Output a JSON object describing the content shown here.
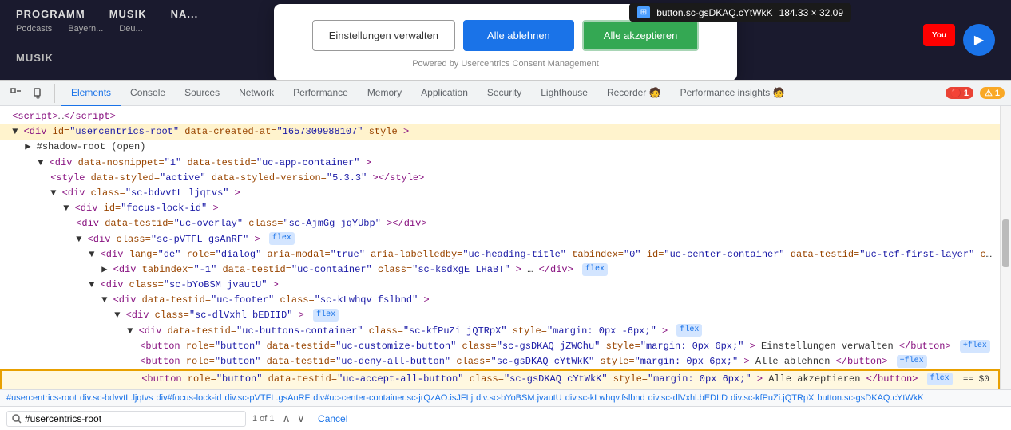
{
  "website": {
    "nav_items": [
      "PROGRAMM",
      "MUSIK",
      "NA..."
    ],
    "sub_items": [
      "Podcasts",
      "Bayern...",
      "Deu..."
    ],
    "music_label": "MUSIK"
  },
  "consent": {
    "manage_label": "Einstellungen verwalten",
    "reject_label": "Alle ablehnen",
    "accept_label": "Alle akzeptieren",
    "powered_text": "Powered by Usercentrics Consent Management"
  },
  "tooltip": {
    "icon_label": "⊞",
    "element_name": "button.sc-gsDKAQ.cYtWkK",
    "dimensions": "184.33 × 32.09"
  },
  "devtools": {
    "tabs": [
      {
        "label": "Elements",
        "active": true
      },
      {
        "label": "Console",
        "active": false
      },
      {
        "label": "Sources",
        "active": false
      },
      {
        "label": "Network",
        "active": false
      },
      {
        "label": "Performance",
        "active": false
      },
      {
        "label": "Memory",
        "active": false
      },
      {
        "label": "Application",
        "active": false
      },
      {
        "label": "Security",
        "active": false
      },
      {
        "label": "Lighthouse",
        "active": false
      },
      {
        "label": "Recorder 🧑",
        "active": false
      },
      {
        "label": "Performance insights 🧑",
        "active": false
      }
    ],
    "error_count": "1",
    "warn_count": "1"
  },
  "dom": {
    "lines": [
      {
        "indent": 0,
        "html": "&lt;script&gt;…&lt;/script&gt;"
      },
      {
        "indent": 0,
        "html": "▼ <span class='tag'>&lt;div</span> <span class='attr-name'>id=</span><span class='attr-value'>\"usercentrics-root\"</span> <span class='attr-name'>data-created-at=</span><span class='attr-value'>\"1657309988107\"</span> <span class='attr-name'>style</span><span class='tag'>&gt;</span>"
      },
      {
        "indent": 1,
        "html": "▶ #shadow-root (open)"
      },
      {
        "indent": 2,
        "html": "▼ <span class='tag'>&lt;div</span> <span class='attr-name'>data-nosnippet=</span><span class='attr-value'>\"1\"</span> <span class='attr-name'>data-testid=</span><span class='attr-value'>\"uc-app-container\"</span><span class='tag'>&gt;</span>"
      },
      {
        "indent": 3,
        "html": "<span class='tag'>&lt;style</span> <span class='attr-name'>data-styled=</span><span class='attr-value'>\"active\"</span> <span class='attr-name'>data-styled-version=</span><span class='attr-value'>\"5.3.3\"</span><span class='tag'>&gt;&lt;/style&gt;</span>"
      },
      {
        "indent": 3,
        "html": "▼ <span class='tag'>&lt;div</span> <span class='attr-name'>class=</span><span class='attr-value'>\"sc-bdvvtL ljqtvs\"</span><span class='tag'>&gt;</span>"
      },
      {
        "indent": 4,
        "html": "▼ <span class='tag'>&lt;div</span> <span class='attr-name'>id=</span><span class='attr-value'>\"focus-lock-id\"</span><span class='tag'>&gt;</span>"
      },
      {
        "indent": 5,
        "html": "<span class='tag'>&lt;div</span> <span class='attr-name'>data-testid=</span><span class='attr-value'>\"uc-overlay\"</span> <span class='attr-name'>class=</span><span class='attr-value'>\"sc-AjmGg jqYUbp\"</span><span class='tag'>&gt;&lt;/div&gt;</span>"
      },
      {
        "indent": 5,
        "html": "▼ <span class='tag'>&lt;div</span> <span class='attr-name'>class=</span><span class='attr-value'>\"sc-pVTFL gsAnRF\"</span><span class='tag'>&gt;</span> <span class='badge-flex'>flex</span>"
      },
      {
        "indent": 6,
        "html": "▼ <span class='tag'>&lt;div</span> <span class='attr-name'>lang=</span><span class='attr-value'>\"de\"</span> <span class='attr-name'>role=</span><span class='attr-value'>\"dialog\"</span> <span class='attr-name'>aria-modal=</span><span class='attr-value'>\"true\"</span> <span class='attr-name'>aria-labelledby=</span><span class='attr-value'>\"uc-heading-title\"</span> <span class='attr-name'>tabindex=</span><span class='attr-value'>\"0\"</span> <span class='attr-name'>id=</span><span class='attr-value'>\"uc-center-container\"</span> <span class='attr-name'>data-testid=</span><span class='attr-value'>\"uc-tcf-first-layer\"</span> <span class='attr-name'>class=</span><span class='attr-value'>\"sc-jrQzAO i</span>"
      },
      {
        "indent": 7,
        "html": "▶ <span class='tag'>&lt;div</span> <span class='attr-name'>tabindex=</span><span class='attr-value'>\"-1\"</span> <span class='attr-name'>data-testid=</span><span class='attr-value'>\"uc-container\"</span> <span class='attr-name'>class=</span><span class='attr-value'>\"sc-ksdxgE LHaBT\"</span><span class='tag'>&gt;</span>…<span class='tag'>&lt;/div&gt;</span> <span class='badge-flex'>flex</span>"
      },
      {
        "indent": 6,
        "html": "▼ <span class='tag'>&lt;div</span> <span class='attr-name'>class=</span><span class='attr-value'>\"sc-bYoBSM jvautU\"</span><span class='tag'>&gt;</span>"
      },
      {
        "indent": 7,
        "html": "▼ <span class='tag'>&lt;div</span> <span class='attr-name'>data-testid=</span><span class='attr-value'>\"uc-footer\"</span> <span class='attr-name'>class=</span><span class='attr-value'>\"sc-kLwhqv fslbnd\"</span><span class='tag'>&gt;</span>"
      },
      {
        "indent": 8,
        "html": "▼ <span class='tag'>&lt;div</span> <span class='attr-name'>class=</span><span class='attr-value'>\"sc-dlVxhl bEDIID\"</span><span class='tag'>&gt;</span> <span class='badge-flex'>flex</span>"
      },
      {
        "indent": 9,
        "html": "▼ <span class='tag'>&lt;div</span> <span class='attr-name'>data-testid=</span><span class='attr-value'>\"uc-buttons-container\"</span> <span class='attr-name'>class=</span><span class='attr-value'>\"sc-kfPuZi jQTRpX\"</span> <span class='attr-name'>style=</span><span class='attr-value'>\"margin: 0px -6px;\"</span><span class='tag'>&gt;</span> <span class='badge-flex'>flex</span>"
      },
      {
        "indent": 10,
        "html": "<span class='tag'>&lt;button</span> <span class='attr-name'>role=</span><span class='attr-value'>\"button\"</span> <span class='attr-name'>data-testid=</span><span class='attr-value'>\"uc-customize-button\"</span> <span class='attr-name'>class=</span><span class='attr-value'>\"sc-gsDKAQ jZWChu\"</span> <span class='attr-name'>style=</span><span class='attr-value'>\"margin: 0px 6px;\"</span><span class='tag'>&gt;</span>Einstellungen verwalten<span class='tag'>&lt;/button&gt;</span> <span class='badge-flex'>+flex</span>"
      },
      {
        "indent": 10,
        "html": "<span class='tag'>&lt;button</span> <span class='attr-name'>role=</span><span class='attr-value'>\"button\"</span> <span class='attr-name'>data-testid=</span><span class='attr-value'>\"uc-deny-all-button\"</span> <span class='attr-name'>class=</span><span class='attr-value'>\"sc-gsDKAQ cYtWkK\"</span> <span class='attr-name'>style=</span><span class='attr-value'>\"margin: 0px 6px;\"</span><span class='tag'>&gt;</span>Alle ablehnen<span class='tag'>&lt;/button&gt;</span> <span class='badge-flex'>+flex</span>"
      },
      {
        "indent": 10,
        "html": "<span class='tag'>&lt;button</span> <span class='attr-name'>role=</span><span class='attr-value'>\"button\"</span> <span class='attr-name'>data-testid=</span><span class='attr-value'>\"uc-accept-all-button\"</span> <span class='attr-name'>class=</span><span class='attr-value'>\"sc-gsDKAQ cYtWkK\"</span> <span class='attr-name'>style=</span><span class='attr-value'>\"margin: 0px 6px;\"</span><span class='tag'>&gt;</span>Alle akzeptieren<span class='tag'>&lt;/button&gt;</span> <span class='badge-flex'>flex</span> <span class='badge-eq'>== $0</span>",
        "selected": true,
        "highlight": true
      }
    ]
  },
  "breadcrumb": {
    "items": [
      "#usercentrics-root",
      "div.sc-bdvvtL.ljqtvs",
      "div#focus-lock-id",
      "div.sc-pVTFL.gsAnRF",
      "div#uc-center-container.sc-jrQzAO.isJFLj",
      "div.sc-bYoBSM.jvautU",
      "div.sc-kLwhqv.fslbnd",
      "div.sc-dlVxhl.bEDIID",
      "div.sc-kfPuZi.jQTRpX",
      "button.sc-gsDKAQ.cYtWkK"
    ]
  },
  "search": {
    "value": "#usercentrics-root",
    "count_text": "1 of 1",
    "cancel_label": "Cancel"
  }
}
